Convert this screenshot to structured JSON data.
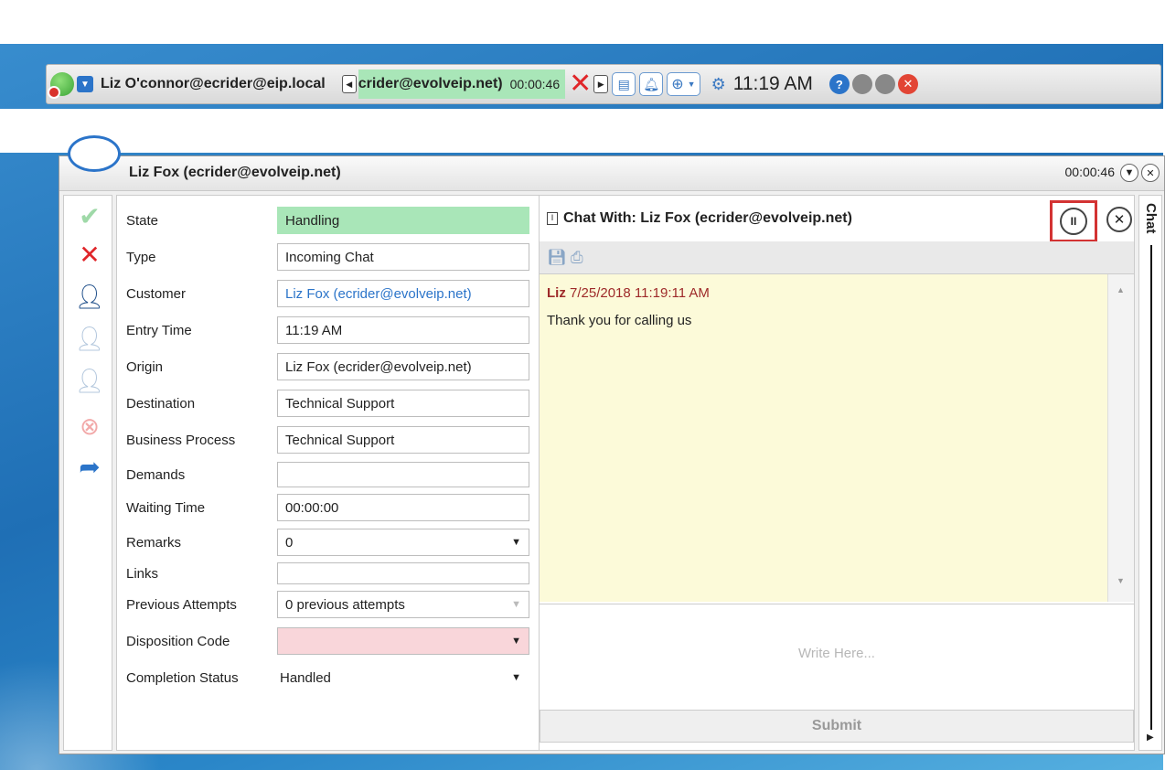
{
  "toolbar": {
    "agent": "Liz O'connor@ecrider@eip.local",
    "active_call_address": "crider@evolveip.net)",
    "active_call_timer": "00:00:46",
    "time": "11:19 AM",
    "help_label": "?"
  },
  "window": {
    "title": "Liz Fox (ecrider@evolveip.net)",
    "timer": "00:00:46"
  },
  "form": {
    "fields": [
      {
        "label": "State",
        "value": "Handling"
      },
      {
        "label": "Type",
        "value": "Incoming Chat"
      },
      {
        "label": "Customer",
        "value": "Liz Fox (ecrider@evolveip.net)"
      },
      {
        "label": "Entry Time",
        "value": "11:19 AM"
      },
      {
        "label": "Origin",
        "value": "Liz Fox (ecrider@evolveip.net)"
      },
      {
        "label": "Destination",
        "value": "Technical Support"
      },
      {
        "label": "Business Process",
        "value": "Technical Support"
      },
      {
        "label": "Demands",
        "value": ""
      },
      {
        "label": "Waiting Time",
        "value": "00:00:00"
      },
      {
        "label": "Remarks",
        "value": "0"
      },
      {
        "label": "Links",
        "value": ""
      },
      {
        "label": "Previous Attempts",
        "value": "0 previous attempts"
      },
      {
        "label": "Disposition Code",
        "value": ""
      },
      {
        "label": "Completion Status",
        "value": "Handled"
      }
    ]
  },
  "chat": {
    "title": "Chat With: Liz Fox (ecrider@evolveip.net)",
    "message_sender": "Liz",
    "message_time": "7/25/2018 11:19:11 AM",
    "message_text": "Thank you for calling us",
    "compose_placeholder": "Write Here...",
    "submit_label": "Submit",
    "side_tab_label": "Chat"
  },
  "colors": {
    "state_green": "#a9e6b8",
    "disposition_pink": "#f9d6da",
    "highlight_red": "#d33333",
    "accent_blue": "#2b74c9"
  }
}
